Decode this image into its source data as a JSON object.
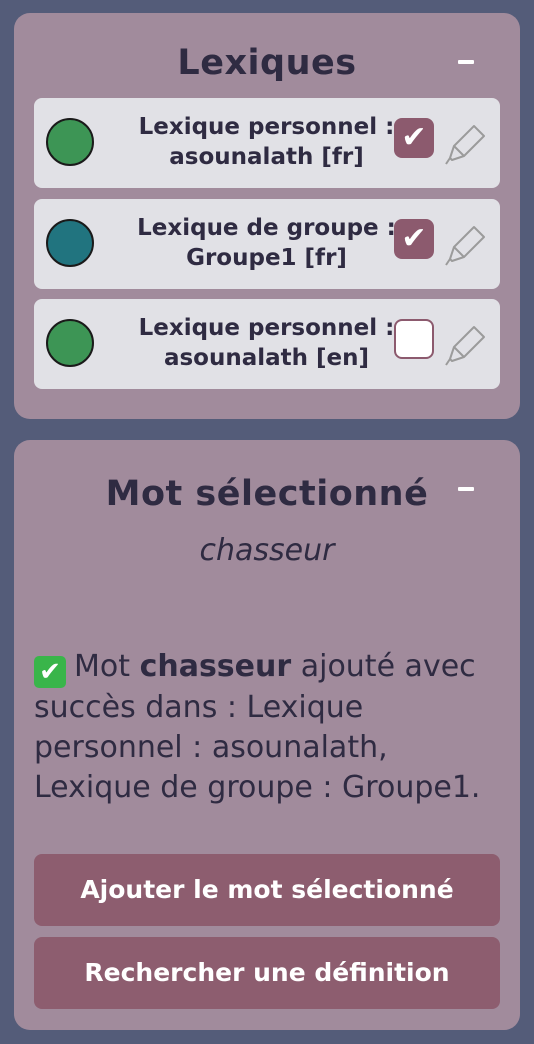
{
  "lexiques": {
    "title": "Lexiques",
    "collapse_label": "−",
    "items": [
      {
        "label_line1": "Lexique personnel :",
        "label_line2": "asounalath [fr]",
        "color": "#3d9555",
        "checked": true,
        "check_mark": "✔"
      },
      {
        "label_line1": "Lexique de groupe :",
        "label_line2": "Groupe1 [fr]",
        "color": "#21747f",
        "checked": true,
        "check_mark": "✔"
      },
      {
        "label_line1": "Lexique personnel :",
        "label_line2": "asounalath [en]",
        "color": "#3d9555",
        "checked": false,
        "check_mark": ""
      }
    ],
    "edit_icon": "highlighter-icon"
  },
  "mot": {
    "title": "Mot sélectionné",
    "collapse_label": "−",
    "selected_word": "chasseur",
    "message": {
      "icon": "✔",
      "prefix": "Mot",
      "word": "chasseur",
      "suffix": "ajouté avec succès dans : Lexique personnel : asounalath, Lexique de groupe : Groupe1."
    },
    "buttons": {
      "add": "Ajouter le mot sélectionné",
      "search": "Rechercher une définition"
    }
  },
  "colors": {
    "background": "#545c79",
    "panel": "#a18b9c",
    "item": "#e1e1e6",
    "accent": "#8d5d6f",
    "text": "#2f2b42"
  }
}
